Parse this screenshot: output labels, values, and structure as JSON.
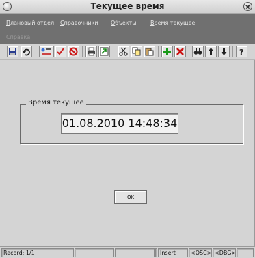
{
  "window": {
    "title": "Текущее время"
  },
  "menu": {
    "items": [
      {
        "label": "Плановый отдел",
        "underline": "П",
        "rest": "лановый отдел"
      },
      {
        "label": "Справочники",
        "underline": "С",
        "rest": "правочники"
      },
      {
        "label": "Объекты",
        "underline": "О",
        "rest": "бъекты"
      },
      {
        "label": "Время текущее",
        "underline": "В",
        "rest": "ремя текущее"
      }
    ],
    "help": {
      "label": "Справка",
      "underline": "С",
      "rest": "правка"
    }
  },
  "toolbar": {
    "icons": [
      "save-icon",
      "refresh-icon",
      "edit-record-icon",
      "check-icon",
      "cancel-icon",
      "print-icon",
      "export-icon",
      "cut-icon",
      "copy-icon",
      "paste-icon",
      "insert-record-icon",
      "delete-record-icon",
      "find-icon",
      "up-arrow-icon",
      "down-arrow-icon",
      "help-icon"
    ]
  },
  "form": {
    "group_label": "Время текущее",
    "time_value": "01.08.2010 14:48:34",
    "ok_label": "OK"
  },
  "status": {
    "record": "Record: 1/1",
    "blank1": "",
    "blank2": "",
    "blank3": "",
    "mode": "Insert",
    "osc": "<OSC>",
    "dbg": "<DBG>"
  },
  "colors": {
    "window_bg": "#d4d4d4",
    "menubar_bg": "#707070",
    "menu_text": "#e6e6e6"
  }
}
